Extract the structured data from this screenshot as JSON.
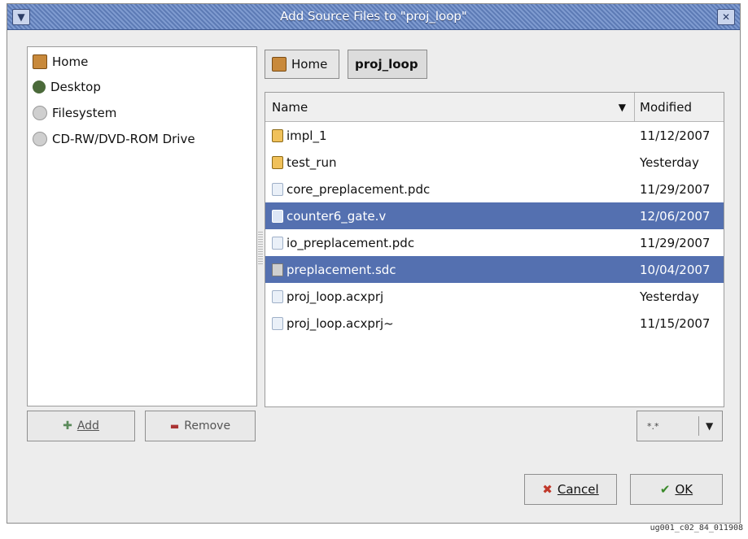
{
  "window": {
    "title": "Add Source Files to \"proj_loop\"",
    "menu_icon": "chevron-down-icon",
    "close_icon": "close-icon"
  },
  "places": {
    "items": [
      {
        "label": "Home",
        "icon": "home-icon"
      },
      {
        "label": "Desktop",
        "icon": "desktop-icon"
      },
      {
        "label": "Filesystem",
        "icon": "filesystem-icon"
      },
      {
        "label": "CD-RW/DVD-ROM Drive",
        "icon": "cdrom-icon"
      }
    ]
  },
  "path": {
    "segments": [
      {
        "label": "Home",
        "icon": "home-icon"
      },
      {
        "label": "proj_loop"
      }
    ]
  },
  "filelist": {
    "columns": [
      "Name",
      "Modified"
    ],
    "rows": [
      {
        "name": "impl_1",
        "modified": "11/12/2007",
        "type": "folder",
        "selected": false
      },
      {
        "name": "test_run",
        "modified": "Yesterday",
        "type": "folder",
        "selected": false
      },
      {
        "name": "core_preplacement.pdc",
        "modified": "11/29/2007",
        "type": "file",
        "selected": false
      },
      {
        "name": "counter6_gate.v",
        "modified": "12/06/2007",
        "type": "file",
        "selected": true
      },
      {
        "name": "io_preplacement.pdc",
        "modified": "11/29/2007",
        "type": "file",
        "selected": false
      },
      {
        "name": "preplacement.sdc",
        "modified": "10/04/2007",
        "type": "sdc",
        "selected": true
      },
      {
        "name": "proj_loop.acxprj",
        "modified": "Yesterday",
        "type": "file",
        "selected": false
      },
      {
        "name": "proj_loop.acxprj~",
        "modified": "11/15/2007",
        "type": "file",
        "selected": false
      }
    ]
  },
  "buttons": {
    "add": "Add",
    "remove": "Remove",
    "cancel": "Cancel",
    "ok": "OK",
    "filter_value": "*.*"
  },
  "caption": "ug001_c02_84_011908",
  "colors": {
    "titlebar": "#6f8cc5",
    "selection": "#5470b0",
    "dialog_bg": "#ededed"
  }
}
